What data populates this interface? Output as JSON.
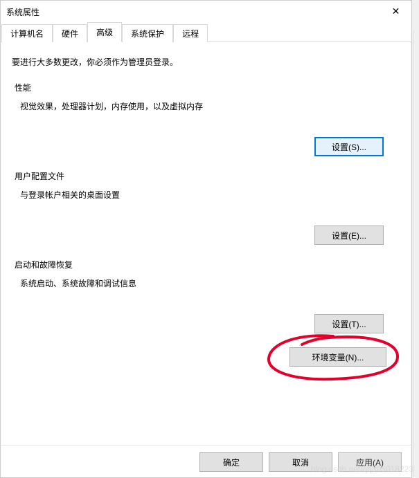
{
  "window": {
    "title": "系统属性",
    "close_glyph": "✕"
  },
  "tabs": {
    "items": [
      {
        "label": "计算机名"
      },
      {
        "label": "硬件"
      },
      {
        "label": "高级",
        "active": true
      },
      {
        "label": "系统保护"
      },
      {
        "label": "远程"
      }
    ]
  },
  "instruction": "要进行大多数更改，你必须作为管理员登录。",
  "groups": {
    "performance": {
      "title": "性能",
      "desc": "视觉效果，处理器计划，内存使用，以及虚拟内存",
      "button": "设置(S)..."
    },
    "userprofile": {
      "title": "用户配置文件",
      "desc": "与登录帐户相关的桌面设置",
      "button": "设置(E)..."
    },
    "startup": {
      "title": "启动和故障恢复",
      "desc": "系统启动、系统故障和调试信息",
      "button": "设置(T)..."
    }
  },
  "env_button": "环境变量(N)...",
  "footer": {
    "ok": "确定",
    "cancel": "取消",
    "apply": "应用(A)"
  },
  "watermark": "blog.csdn.net/qq305018223"
}
